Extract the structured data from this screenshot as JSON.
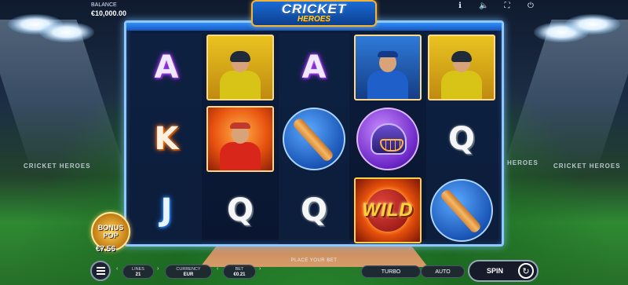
{
  "header": {
    "balance_label": "BALANCE",
    "balance_value": "€10,000.00",
    "logo_line1": "CRICKET",
    "logo_line2": "HEROES",
    "icons": [
      "info-icon",
      "sound-icon",
      "fullscreen-icon",
      "power-icon"
    ]
  },
  "stadium": {
    "sign_left": "CRICKET HEROES",
    "sign_right_1": "HEROES",
    "sign_right_2": "CRICKET HEROES"
  },
  "reels": [
    [
      "A",
      "K",
      "J"
    ],
    [
      "batsman-yellow",
      "fielder-red",
      "Q"
    ],
    [
      "A",
      "bat-blue",
      "Q"
    ],
    [
      "player-blue",
      "helmet-purple",
      "WILD"
    ],
    [
      "batsman-yellow",
      "Q",
      "bat-blue"
    ]
  ],
  "bonus": {
    "line1": "BONUS",
    "line2": "POP",
    "amount": "€7.56"
  },
  "bottom": {
    "place_bet": "PLACE YOUR BET",
    "lines_label": "LINES",
    "lines_value": "21",
    "currency_label": "CURRENCY",
    "currency_value": "EUR",
    "bet_label": "BET",
    "bet_value": "€0.21",
    "turbo_label": "TURBO",
    "auto_label": "AUTO",
    "spin_label": "SPIN"
  },
  "colors": {
    "frame": "#8fc7ff",
    "accent": "#f3b43a"
  }
}
